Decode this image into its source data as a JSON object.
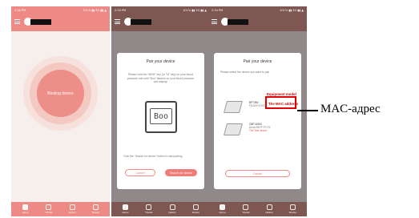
{
  "status_bar": {
    "time": "2:34 PM",
    "icons": "101% ▮▮ 5G ▮▮ ▲"
  },
  "phone1": {
    "binding_label": "Binding device"
  },
  "phone2": {
    "title": "Pair your device",
    "instructions": "Please hold the \"MEM\" key (or \"M\" key) on your blood pressure unit until \"Boo\" flashes on your blood pressure unit display.",
    "device_screen": "Boo",
    "hint": "Click the \"Search for device\" button to start pairing.",
    "cancel_label": "Cancel",
    "search_label": "Search for device"
  },
  "phone3": {
    "title": "Pair your device",
    "instructions": "Please select the device you want to pair",
    "devices": [
      {
        "model": "BP7350",
        "mac": "F8:A3:F4:04:E3:7E",
        "note": ""
      },
      {
        "model": "CBP-W100",
        "mac": "84:a6:96:FF:FF:F2",
        "note": "The Test device"
      }
    ],
    "cancel_label": "Cancel"
  },
  "annotations": {
    "equipment_model": "Equipment model",
    "mac_address": "The MAC address",
    "callout": "MAC-адрес"
  },
  "tabs": [
    {
      "label": "Home",
      "icon": "home-icon"
    },
    {
      "label": "Trends",
      "icon": "trends-icon"
    },
    {
      "label": "History",
      "icon": "history-icon"
    },
    {
      "label": "Device",
      "icon": "device-icon"
    }
  ],
  "colors": {
    "accent": "#ee8a86",
    "header_dark": "#7e5753",
    "highlight": "#e00000"
  }
}
